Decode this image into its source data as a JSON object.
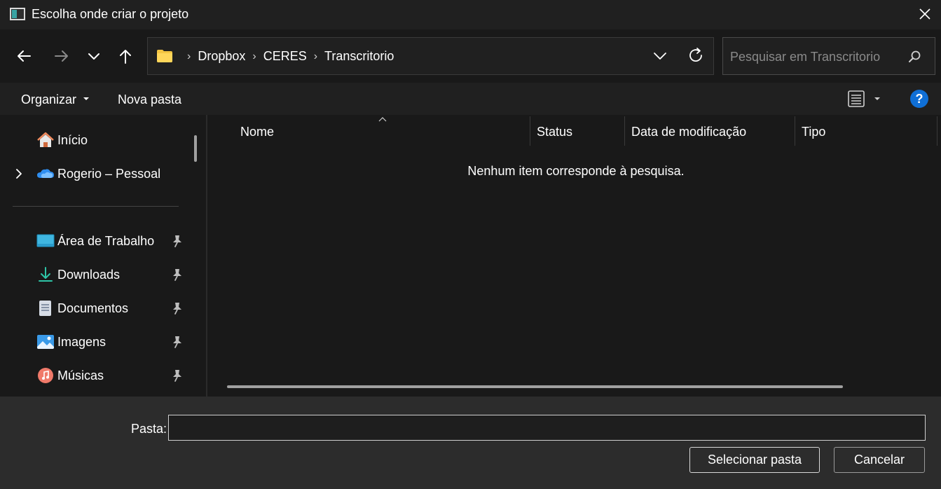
{
  "window": {
    "title": "Escolha onde criar o projeto"
  },
  "address": {
    "crumbs": [
      "Dropbox",
      "CERES",
      "Transcritorio"
    ]
  },
  "search": {
    "placeholder": "Pesquisar em Transcritorio"
  },
  "commands": {
    "organize": "Organizar",
    "new_folder": "Nova pasta"
  },
  "help": {
    "glyph": "?"
  },
  "sidebar": {
    "items": [
      {
        "label": "Início",
        "icon": "home-icon"
      },
      {
        "label": "Rogerio – Pessoal",
        "icon": "onedrive-cloud-icon"
      },
      {
        "label": "Área de Trabalho",
        "icon": "desktop-icon",
        "pinned": true
      },
      {
        "label": "Downloads",
        "icon": "downloads-icon",
        "pinned": true
      },
      {
        "label": "Documentos",
        "icon": "documents-icon",
        "pinned": true
      },
      {
        "label": "Imagens",
        "icon": "pictures-icon",
        "pinned": true
      },
      {
        "label": "Músicas",
        "icon": "music-icon",
        "pinned": true
      }
    ]
  },
  "columns": [
    "Nome",
    "Status",
    "Data de modificação",
    "Tipo"
  ],
  "empty_message": "Nenhum item corresponde à pesquisa.",
  "footer": {
    "folder_label": "Pasta:",
    "folder_value": "",
    "select_button": "Selecionar pasta",
    "cancel_button": "Cancelar"
  },
  "colors": {
    "accent": "#0f6fd6",
    "folder": "#f4c542",
    "background": "#191919"
  }
}
